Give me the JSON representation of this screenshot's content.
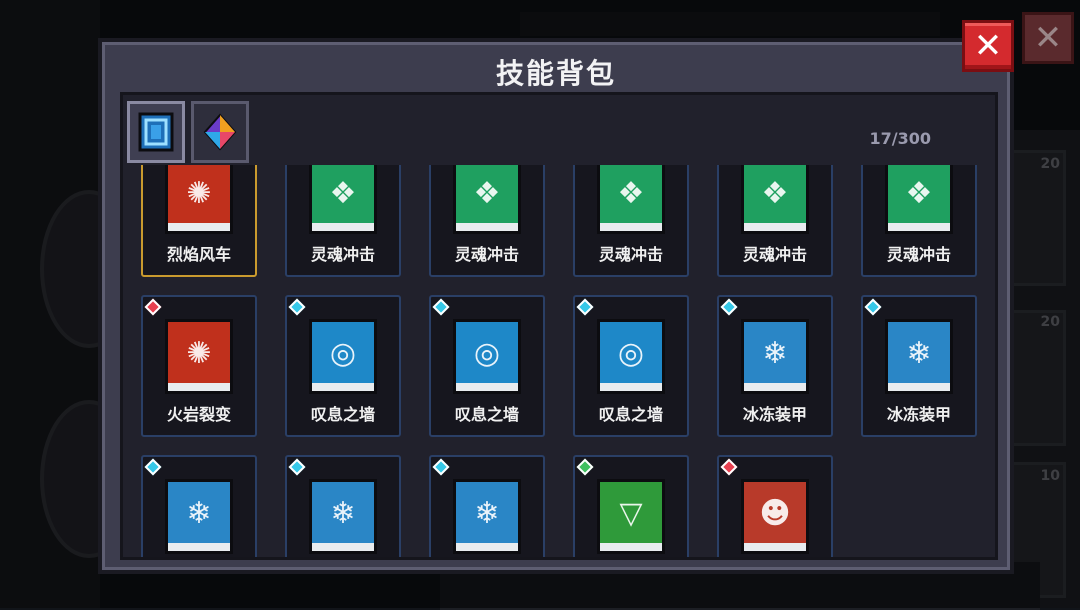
{
  "panel": {
    "title": "技能背包",
    "count": "17/300"
  },
  "filters": [
    {
      "name": "filter-all-icon",
      "color": "#3aa0e8"
    },
    {
      "name": "filter-gem-icon",
      "color": "#f0a020"
    }
  ],
  "colors": {
    "fire": "#c0301c",
    "soul": "#1fa060",
    "sigh": "#1e88c8",
    "ice": "#2a86c6",
    "earth": "#2f9a3a",
    "beast": "#b83a2a",
    "gem_blue": "#35c8e8",
    "gem_red": "#e84050",
    "gem_green": "#40c060",
    "close": "#d42a2e"
  },
  "skills": [
    {
      "label": "烈焰风车",
      "kind": "fire",
      "gem": "",
      "selected": true
    },
    {
      "label": "灵魂冲击",
      "kind": "soul",
      "gem": ""
    },
    {
      "label": "灵魂冲击",
      "kind": "soul",
      "gem": ""
    },
    {
      "label": "灵魂冲击",
      "kind": "soul",
      "gem": ""
    },
    {
      "label": "灵魂冲击",
      "kind": "soul",
      "gem": ""
    },
    {
      "label": "灵魂冲击",
      "kind": "soul",
      "gem": ""
    },
    {
      "label": "火岩裂变",
      "kind": "fire",
      "gem": "red"
    },
    {
      "label": "叹息之墙",
      "kind": "sigh",
      "gem": "blue"
    },
    {
      "label": "叹息之墙",
      "kind": "sigh",
      "gem": "blue"
    },
    {
      "label": "叹息之墙",
      "kind": "sigh",
      "gem": "blue"
    },
    {
      "label": "冰冻装甲",
      "kind": "ice",
      "gem": "blue"
    },
    {
      "label": "冰冻装甲",
      "kind": "ice",
      "gem": "blue"
    },
    {
      "label": "",
      "kind": "ice",
      "gem": "blue"
    },
    {
      "label": "",
      "kind": "ice",
      "gem": "blue"
    },
    {
      "label": "",
      "kind": "ice",
      "gem": "blue"
    },
    {
      "label": "",
      "kind": "earth",
      "gem": "green"
    },
    {
      "label": "",
      "kind": "beast",
      "gem": "red"
    }
  ],
  "background": {
    "slot_numbers": [
      "20",
      "20",
      "10"
    ]
  }
}
